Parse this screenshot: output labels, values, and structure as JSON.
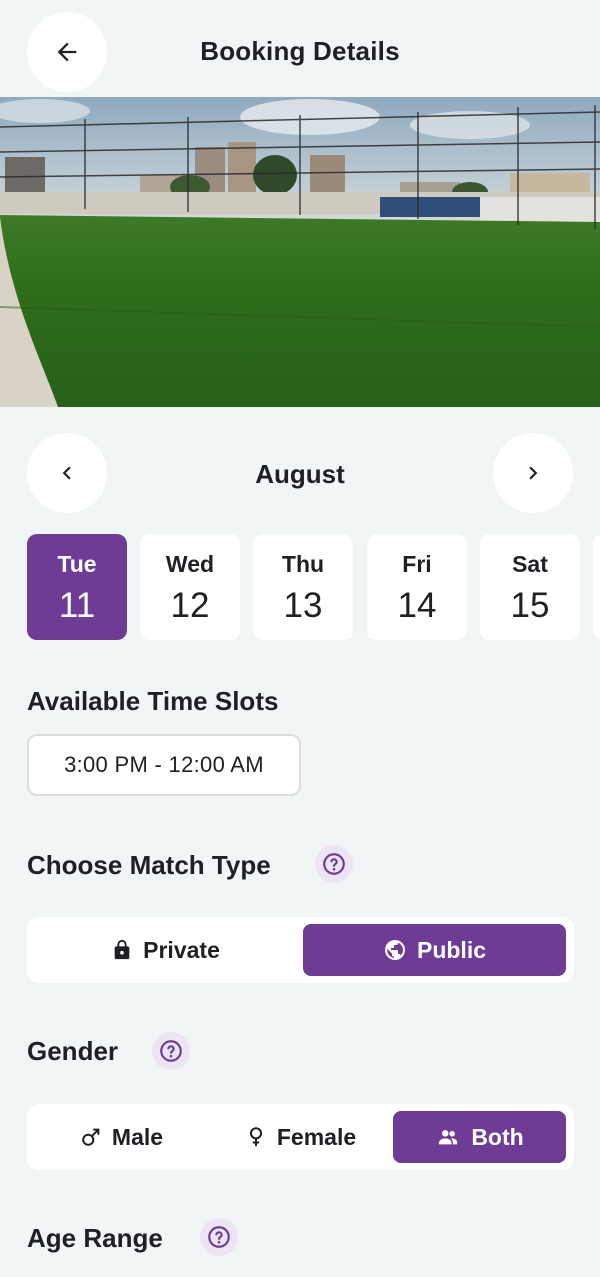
{
  "header": {
    "title": "Booking Details",
    "back_icon": "arrow-left-icon"
  },
  "hero": {
    "image": "turf-field-photo"
  },
  "calendar": {
    "month": "August",
    "days": [
      {
        "dow": "Tue",
        "date": "11",
        "selected": true
      },
      {
        "dow": "Wed",
        "date": "12",
        "selected": false
      },
      {
        "dow": "Thu",
        "date": "13",
        "selected": false
      },
      {
        "dow": "Fri",
        "date": "14",
        "selected": false
      },
      {
        "dow": "Sat",
        "date": "15",
        "selected": false
      }
    ]
  },
  "time_slots": {
    "title": "Available Time Slots",
    "slots": [
      "3:00 PM - 12:00 AM"
    ]
  },
  "match_type": {
    "title": "Choose Match Type",
    "options": [
      {
        "label": "Private",
        "icon": "lock-icon",
        "active": false
      },
      {
        "label": "Public",
        "icon": "globe-icon",
        "active": true
      }
    ]
  },
  "gender": {
    "title": "Gender",
    "options": [
      {
        "label": "Male",
        "icon": "male-icon",
        "active": false
      },
      {
        "label": "Female",
        "icon": "female-icon",
        "active": false
      },
      {
        "label": "Both",
        "icon": "group-icon",
        "active": true
      }
    ]
  },
  "age_range": {
    "title": "Age Range"
  },
  "colors": {
    "accent": "#6f3c95",
    "background": "#f2f5f6",
    "help_bg": "#ece4f3"
  }
}
